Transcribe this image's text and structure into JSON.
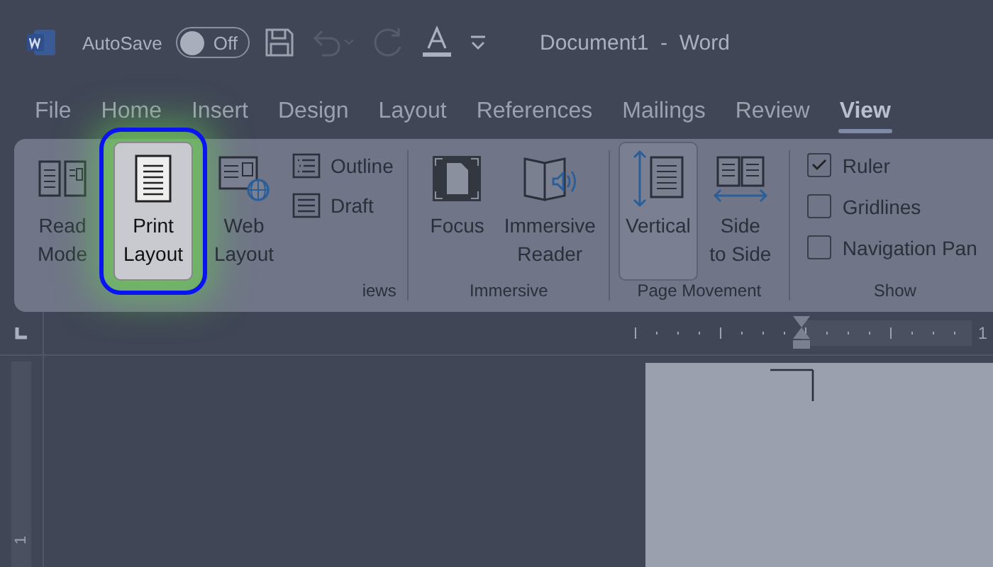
{
  "title_bar": {
    "autosave_label": "AutoSave",
    "autosave_toggle": {
      "on": false,
      "label": "Off"
    },
    "document_title": "Document1  -  Word"
  },
  "tabs": [
    {
      "label": "File",
      "selected": false
    },
    {
      "label": "Home",
      "selected": false
    },
    {
      "label": "Insert",
      "selected": false
    },
    {
      "label": "Design",
      "selected": false
    },
    {
      "label": "Layout",
      "selected": false
    },
    {
      "label": "References",
      "selected": false
    },
    {
      "label": "Mailings",
      "selected": false
    },
    {
      "label": "Review",
      "selected": false
    },
    {
      "label": "View",
      "selected": true
    }
  ],
  "ribbon_groups": [
    {
      "label": "iews",
      "items": [
        {
          "kind": "large",
          "label": "Read\nMode",
          "selected": false,
          "highlighted": false
        },
        {
          "kind": "large",
          "label": "Print\nLayout",
          "selected": true,
          "highlighted": true
        },
        {
          "kind": "large",
          "label": "Web\nLayout",
          "selected": false,
          "highlighted": false
        },
        {
          "kind": "small",
          "label": "Outline"
        },
        {
          "kind": "small",
          "label": "Draft"
        }
      ]
    },
    {
      "label": "Immersive",
      "items": [
        {
          "kind": "large",
          "label": "Focus",
          "selected": false,
          "highlighted": false
        },
        {
          "kind": "large",
          "label": "Immersive\nReader",
          "selected": false,
          "highlighted": false
        }
      ]
    },
    {
      "label": "Page Movement",
      "items": [
        {
          "kind": "large",
          "label": "Vertical",
          "selected": true,
          "highlighted": false
        },
        {
          "kind": "large",
          "label": "Side\nto Side",
          "selected": false,
          "highlighted": false
        }
      ]
    },
    {
      "label": "Show",
      "items": [
        {
          "kind": "check",
          "label": "Ruler",
          "checked": true
        },
        {
          "kind": "check",
          "label": "Gridlines",
          "checked": false
        },
        {
          "kind": "check",
          "label": "Navigation Pan",
          "checked": false
        }
      ]
    }
  ],
  "horizontal_ruler": {
    "number": "1"
  },
  "vertical_ruler": {
    "number": "1"
  }
}
